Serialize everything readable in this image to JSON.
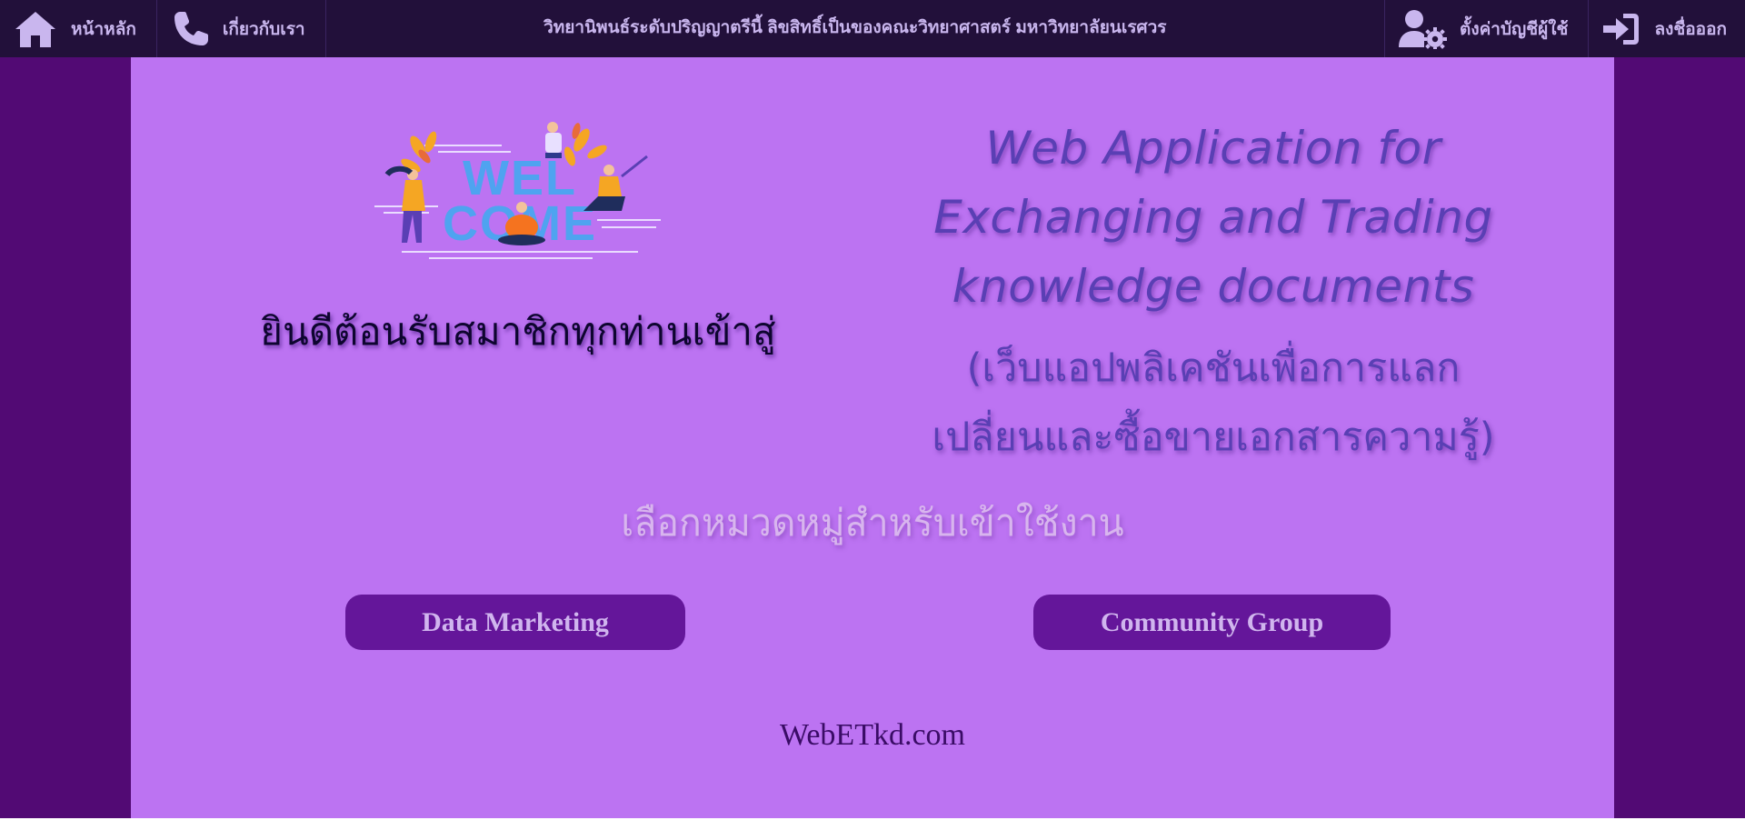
{
  "nav": {
    "home_label": "หน้าหลัก",
    "about_label": "เกี่ยวกับเรา",
    "title": "วิทยานิพนธ์ระดับปริญญาตรีนี้ ลิขสิทธิ์เป็นของคณะวิทยาศาสตร์ มหาวิทยาลัยนเรศวร",
    "account_settings_label": "ตั้งค่าบัญชีผู้ใช้",
    "logout_label": "ลงชื่อออก",
    "icons": [
      "home-icon",
      "phone-icon",
      "user-gear-icon",
      "sign-in-icon"
    ]
  },
  "hero": {
    "welcome_image_text": "WELCOME",
    "welcome_message": "ยินดีต้อนรับสมาชิกทุกท่านเข้าสู่",
    "app_title_lines": [
      "Web Application for",
      "Exchanging and Trading",
      "knowledge documents"
    ],
    "app_subtitle_lines": [
      "(เว็บแอปพลิเคชันเพื่อการแลก",
      "เปลี่ยนและซื้อขายเอกสารความรู้)"
    ]
  },
  "categories": {
    "prompt": "เลือกหมวดหมู่สำหรับเข้าใช้งาน",
    "buttons": [
      "Data Marketing",
      "Community Group"
    ]
  },
  "footer": {
    "site_name": "WebETkd.com"
  },
  "colors": {
    "navbar": "#22103a",
    "nav_text": "#c9b6ee",
    "outer_background": "#520a74",
    "main_panel": "#bc73f2",
    "button": "#64169a",
    "title_text": "#5a3fb4"
  }
}
